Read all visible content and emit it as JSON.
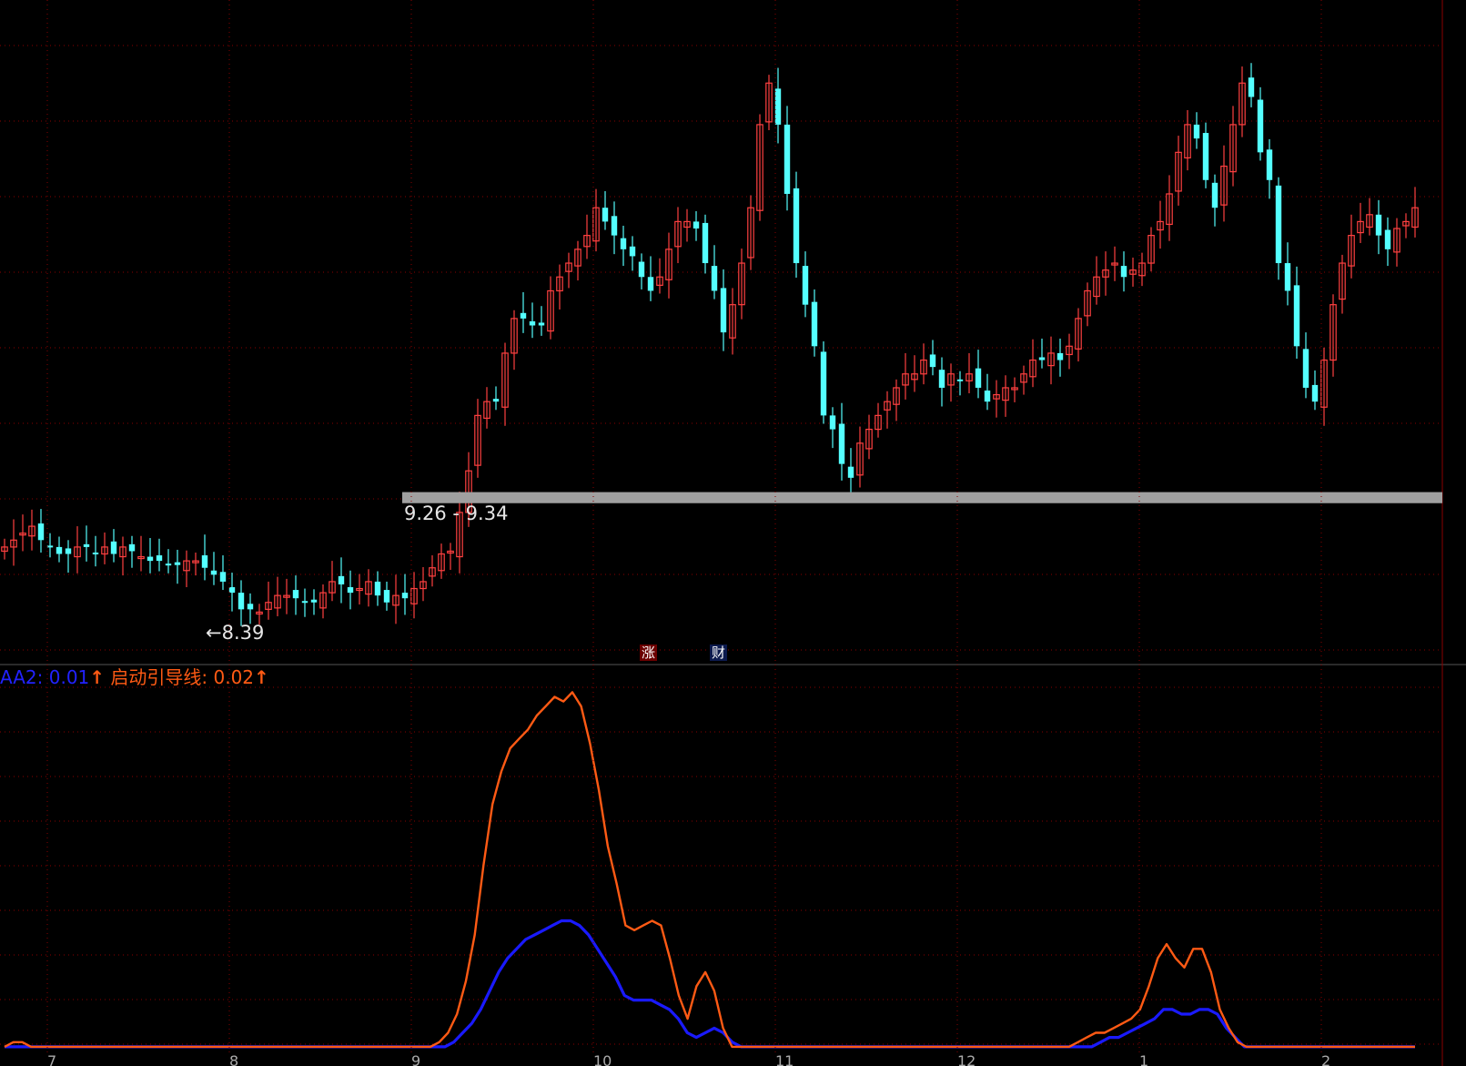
{
  "colors": {
    "background": "#000000",
    "bullish_candle": "#ff4040",
    "bearish_candle": "#54ffff",
    "neutral_candle": "#ffffff",
    "grid": "#8a0000",
    "support_band": "#a0a0a0",
    "aa2_line": "#1a1aff",
    "guide_line": "#ff5a14",
    "text_light": "#e6e6e6"
  },
  "price_panel": {
    "support_range_label": "9.26 - 9.34",
    "low_marker": "←8.39",
    "event_badges": [
      {
        "name": "rise-badge",
        "text": "涨"
      },
      {
        "name": "finance-badge",
        "text": "财"
      }
    ]
  },
  "indicator_panel": {
    "aa2_label": "AA2: 0.01",
    "aa2_arrow": "↑",
    "guide_label": "启动引导线: 0.02",
    "guide_arrow": "↑"
  },
  "chart_data": [
    {
      "type": "candlestick",
      "title": "",
      "x_month_ticks": [
        "7",
        "8",
        "9",
        "10",
        "11",
        "12",
        "1",
        "2"
      ],
      "support_band": [
        9.26,
        9.34
      ],
      "annotated_low": 8.39,
      "ylim": [
        8.2,
        12.9
      ],
      "series_close": [
        8.95,
        9.0,
        9.05,
        9.1,
        9.0,
        8.95,
        8.9,
        8.9,
        8.95,
        8.95,
        8.9,
        8.95,
        8.9,
        8.95,
        8.92,
        8.88,
        8.85,
        8.85,
        8.82,
        8.82,
        8.85,
        8.85,
        8.8,
        8.75,
        8.7,
        8.62,
        8.5,
        8.5,
        8.48,
        8.55,
        8.6,
        8.6,
        8.58,
        8.55,
        8.55,
        8.62,
        8.7,
        8.68,
        8.62,
        8.65,
        8.7,
        8.6,
        8.55,
        8.6,
        8.58,
        8.65,
        8.7,
        8.8,
        8.9,
        8.92,
        9.2,
        9.5,
        9.9,
        10.0,
        10.0,
        10.35,
        10.6,
        10.6,
        10.55,
        10.55,
        10.8,
        10.9,
        11.0,
        11.1,
        11.2,
        11.4,
        11.3,
        11.2,
        11.1,
        11.05,
        10.9,
        10.8,
        10.9,
        11.1,
        11.3,
        11.3,
        11.25,
        11.0,
        10.8,
        10.5,
        10.7,
        11.0,
        11.4,
        12.0,
        12.3,
        12.0,
        11.5,
        11.0,
        10.7,
        10.4,
        9.9,
        9.8,
        9.55,
        9.45,
        9.7,
        9.8,
        9.9,
        10.0,
        10.1,
        10.2,
        10.2,
        10.3,
        10.25,
        10.1,
        10.2,
        10.15,
        10.2,
        10.1,
        10.0,
        10.05,
        10.1,
        10.1,
        10.2,
        10.3,
        10.3,
        10.35,
        10.3,
        10.4,
        10.6,
        10.8,
        10.9,
        10.95,
        11.0,
        10.9,
        10.95,
        11.0,
        11.2,
        11.3,
        11.5,
        11.8,
        12.0,
        11.9,
        11.6,
        11.4,
        11.7,
        12.0,
        12.3,
        12.2,
        11.8,
        11.6,
        11.0,
        10.8,
        10.4,
        10.1,
        10.0,
        10.3,
        10.7,
        11.0,
        11.2,
        11.3,
        11.35,
        11.2,
        11.1,
        11.25,
        11.3,
        11.4
      ]
    },
    {
      "type": "line",
      "title": "",
      "ylim": [
        0,
        0.8
      ],
      "series": [
        {
          "name": "AA2",
          "values": [
            0.01,
            0.01,
            0.01,
            0.01,
            0.01,
            0.01,
            0.01,
            0.01,
            0.01,
            0.01,
            0.01,
            0.01,
            0.01,
            0.01,
            0.01,
            0.01,
            0.01,
            0.01,
            0.01,
            0.01,
            0.01,
            0.01,
            0.01,
            0.01,
            0.01,
            0.01,
            0.01,
            0.01,
            0.01,
            0.01,
            0.01,
            0.01,
            0.01,
            0.01,
            0.01,
            0.01,
            0.01,
            0.01,
            0.01,
            0.01,
            0.01,
            0.01,
            0.01,
            0.01,
            0.01,
            0.01,
            0.01,
            0.01,
            0.01,
            0.01,
            0.02,
            0.04,
            0.06,
            0.09,
            0.13,
            0.17,
            0.2,
            0.22,
            0.24,
            0.25,
            0.26,
            0.27,
            0.28,
            0.28,
            0.27,
            0.25,
            0.22,
            0.19,
            0.16,
            0.12,
            0.11,
            0.11,
            0.11,
            0.1,
            0.09,
            0.07,
            0.04,
            0.03,
            0.04,
            0.05,
            0.04,
            0.02,
            0.01,
            0.01,
            0.01,
            0.01,
            0.01,
            0.01,
            0.01,
            0.01,
            0.01,
            0.01,
            0.01,
            0.01,
            0.01,
            0.01,
            0.01,
            0.01,
            0.01,
            0.01,
            0.01,
            0.01,
            0.01,
            0.01,
            0.01,
            0.01,
            0.01,
            0.01,
            0.01,
            0.01,
            0.01,
            0.01,
            0.01,
            0.01,
            0.01,
            0.01,
            0.01,
            0.01,
            0.01,
            0.01,
            0.01,
            0.01,
            0.02,
            0.03,
            0.03,
            0.04,
            0.05,
            0.06,
            0.07,
            0.09,
            0.09,
            0.08,
            0.08,
            0.09,
            0.09,
            0.08,
            0.05,
            0.03,
            0.01,
            0.01,
            0.01,
            0.01,
            0.01,
            0.01,
            0.01,
            0.01,
            0.01,
            0.01,
            0.01,
            0.01,
            0.01,
            0.01,
            0.01,
            0.01,
            0.01,
            0.01,
            0.01,
            0.01
          ]
        },
        {
          "name": "启动引导线",
          "values": [
            0.01,
            0.02,
            0.02,
            0.01,
            0.01,
            0.01,
            0.01,
            0.01,
            0.01,
            0.01,
            0.01,
            0.01,
            0.01,
            0.01,
            0.01,
            0.01,
            0.01,
            0.01,
            0.01,
            0.01,
            0.01,
            0.01,
            0.01,
            0.01,
            0.01,
            0.01,
            0.01,
            0.01,
            0.01,
            0.01,
            0.01,
            0.01,
            0.01,
            0.01,
            0.01,
            0.01,
            0.01,
            0.01,
            0.01,
            0.01,
            0.01,
            0.01,
            0.01,
            0.01,
            0.01,
            0.01,
            0.01,
            0.01,
            0.01,
            0.02,
            0.04,
            0.08,
            0.15,
            0.25,
            0.4,
            0.53,
            0.6,
            0.65,
            0.67,
            0.69,
            0.72,
            0.74,
            0.76,
            0.75,
            0.77,
            0.74,
            0.66,
            0.56,
            0.44,
            0.36,
            0.27,
            0.26,
            0.27,
            0.28,
            0.27,
            0.2,
            0.12,
            0.07,
            0.14,
            0.17,
            0.13,
            0.05,
            0.01,
            0.01,
            0.01,
            0.01,
            0.01,
            0.01,
            0.01,
            0.01,
            0.01,
            0.01,
            0.01,
            0.01,
            0.01,
            0.01,
            0.01,
            0.01,
            0.01,
            0.01,
            0.01,
            0.01,
            0.01,
            0.01,
            0.01,
            0.01,
            0.01,
            0.01,
            0.01,
            0.01,
            0.01,
            0.01,
            0.01,
            0.01,
            0.01,
            0.01,
            0.01,
            0.01,
            0.01,
            0.01,
            0.01,
            0.02,
            0.03,
            0.04,
            0.04,
            0.05,
            0.06,
            0.07,
            0.09,
            0.14,
            0.2,
            0.23,
            0.2,
            0.18,
            0.22,
            0.22,
            0.17,
            0.09,
            0.05,
            0.02,
            0.01,
            0.01,
            0.01,
            0.01,
            0.01,
            0.01,
            0.01,
            0.01,
            0.01,
            0.01,
            0.01,
            0.01,
            0.01,
            0.01,
            0.01,
            0.01,
            0.01,
            0.01,
            0.01,
            0.01
          ]
        }
      ]
    }
  ]
}
